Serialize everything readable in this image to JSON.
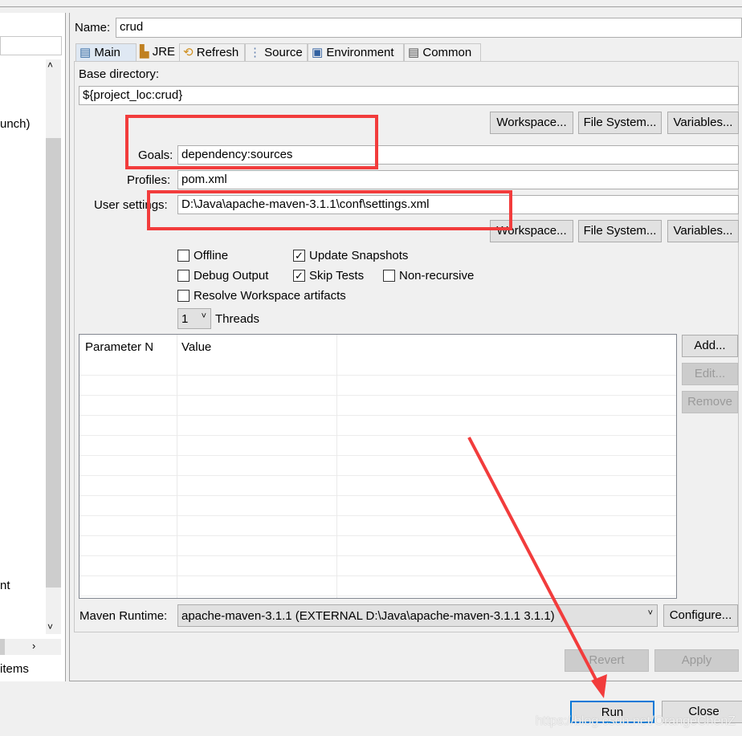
{
  "left_panel": {
    "partial_text_1": "unch)",
    "partial_text_2": "nt",
    "footer_text": "items"
  },
  "name": {
    "label": "Name:",
    "value": "crud"
  },
  "tabs": [
    {
      "label": "Main",
      "icon": "main-tab-icon"
    },
    {
      "label": "JRE",
      "icon": "jre-icon"
    },
    {
      "label": "Refresh",
      "icon": "refresh-icon"
    },
    {
      "label": "Source",
      "icon": "source-icon"
    },
    {
      "label": "Environment",
      "icon": "environment-icon"
    },
    {
      "label": "Common",
      "icon": "common-icon"
    }
  ],
  "main": {
    "base_directory_label": "Base directory:",
    "base_directory_value": "${project_loc:crud}",
    "workspace_btn": "Workspace...",
    "filesystem_btn": "File System...",
    "variables_btn": "Variables...",
    "goals_label": "Goals:",
    "goals_value": "dependency:sources",
    "profiles_label": "Profiles:",
    "profiles_value": "pom.xml",
    "user_settings_label": "User settings:",
    "user_settings_value": "D:\\Java\\apache-maven-3.1.1\\conf\\settings.xml",
    "options": {
      "offline": {
        "label": "Offline",
        "checked": false
      },
      "update_snapshots": {
        "label": "Update Snapshots",
        "checked": true
      },
      "debug_output": {
        "label": "Debug Output",
        "checked": false
      },
      "skip_tests": {
        "label": "Skip Tests",
        "checked": true
      },
      "non_recursive": {
        "label": "Non-recursive",
        "checked": false
      },
      "resolve_workspace": {
        "label": "Resolve Workspace artifacts",
        "checked": false
      }
    },
    "threads_value": "1",
    "threads_label": "Threads",
    "table_headers": [
      "Parameter N",
      "Value"
    ],
    "add_btn": "Add...",
    "edit_btn": "Edit...",
    "remove_btn": "Remove",
    "maven_runtime_label": "Maven Runtime:",
    "maven_runtime_value": "apache-maven-3.1.1 (EXTERNAL D:\\Java\\apache-maven-3.1.1 3.1.1)",
    "configure_btn": "Configure..."
  },
  "revert_btn": "Revert",
  "apply_btn": "Apply",
  "run_btn": "Run",
  "close_btn": "Close",
  "watermark": "https://blog.csdn.net/OrangeChenZ",
  "annotation_color": "#f23c3c"
}
